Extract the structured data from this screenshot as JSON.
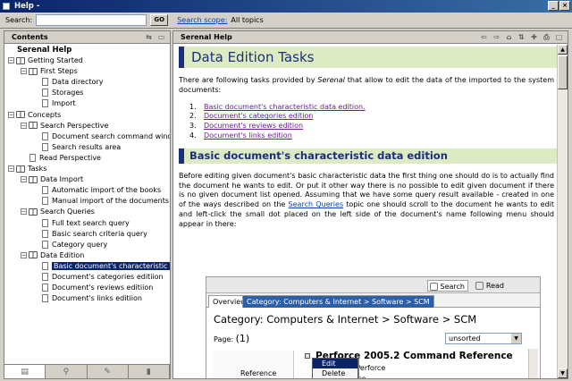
{
  "window": {
    "title": "Help -"
  },
  "search": {
    "label": "Search:",
    "value": "",
    "go_label": "GO",
    "scope_link": "Search scope:",
    "scope_value": "All topics"
  },
  "left_pane": {
    "title": "Contents",
    "tree": [
      {
        "label": "Serenal Help",
        "level": 0,
        "kind": "root"
      },
      {
        "label": "Getting Started",
        "level": 0,
        "kind": "book"
      },
      {
        "label": "First Steps",
        "level": 1,
        "kind": "book"
      },
      {
        "label": "Data directory",
        "level": 2,
        "kind": "page"
      },
      {
        "label": "Storages",
        "level": 2,
        "kind": "page"
      },
      {
        "label": "Import",
        "level": 2,
        "kind": "page"
      },
      {
        "label": "Concepts",
        "level": 0,
        "kind": "book"
      },
      {
        "label": "Search Perspective",
        "level": 1,
        "kind": "book"
      },
      {
        "label": "Document search command window",
        "level": 2,
        "kind": "page"
      },
      {
        "label": "Search results area",
        "level": 2,
        "kind": "page"
      },
      {
        "label": "Read Perspective",
        "level": 1,
        "kind": "page"
      },
      {
        "label": "Tasks",
        "level": 0,
        "kind": "book"
      },
      {
        "label": "Data Import",
        "level": 1,
        "kind": "book"
      },
      {
        "label": "Automatic import of the books",
        "level": 2,
        "kind": "page"
      },
      {
        "label": "Manual import of the documents",
        "level": 2,
        "kind": "page"
      },
      {
        "label": "Search Queries",
        "level": 1,
        "kind": "book"
      },
      {
        "label": "Full text search query",
        "level": 2,
        "kind": "page"
      },
      {
        "label": "Basic search criteria query",
        "level": 2,
        "kind": "page"
      },
      {
        "label": "Category query",
        "level": 2,
        "kind": "page"
      },
      {
        "label": "Data Edition",
        "level": 1,
        "kind": "book"
      },
      {
        "label": "Basic document's characteristic data edition",
        "level": 2,
        "kind": "page",
        "selected": true
      },
      {
        "label": "Document's categories editiion",
        "level": 2,
        "kind": "page"
      },
      {
        "label": "Document's reviews editiion",
        "level": 2,
        "kind": "page"
      },
      {
        "label": "Document's links editiion",
        "level": 2,
        "kind": "page"
      }
    ]
  },
  "right_pane": {
    "title": "Serenal Help",
    "page_title": "Data Edition Tasks",
    "intro_before": "There are following tasks provided by ",
    "intro_em": "Serenal",
    "intro_after": " that allow to edit the data of the imported to the system documents:",
    "tasks": [
      {
        "num": "1.",
        "label": "Basic document's characteristic data edition."
      },
      {
        "num": "2.",
        "label": "Document's categories edition"
      },
      {
        "num": "3.",
        "label": "Document's reviews edition"
      },
      {
        "num": "4.",
        "label": "Document's links edition"
      }
    ],
    "section_title": "Basic document's characteristic data edition",
    "body_before": "Before editing given document's basic characteristic data the first thing one should do is to actually find the document he wants to edit. Or put it other way there is no possible to edit given document if there is no given document list opened. Assuming that we have some query result available - created in one of the ways described on the ",
    "body_link": "Search Queries",
    "body_after": " topic one should scroll to the document he wants to edit and left-click the small dot placed on the left side of the document's name following menu should appear in there:",
    "screenshot": {
      "search_btn": "Search",
      "read_btn": "Read",
      "tab_overview": "Overview",
      "tab_category": "Category: Computers & Internet > Software > SCM",
      "category_title": "Category: Computers & Internet > Software > SCM",
      "page_label": "Page:",
      "page_value": "(1)",
      "sort_value": "unsorted",
      "book_title": "Perforce 2005.2 Command Reference",
      "byline": "by Perforce",
      "publisher": "rforce",
      "ref_label": "Reference",
      "menu_edit": "Edit",
      "menu_delete": "Delete"
    }
  },
  "colors": {
    "heading_bg": "#dcebc4",
    "heading_fg": "#1c2f7a",
    "selection": "#0a246a",
    "link": "#0645ad"
  }
}
